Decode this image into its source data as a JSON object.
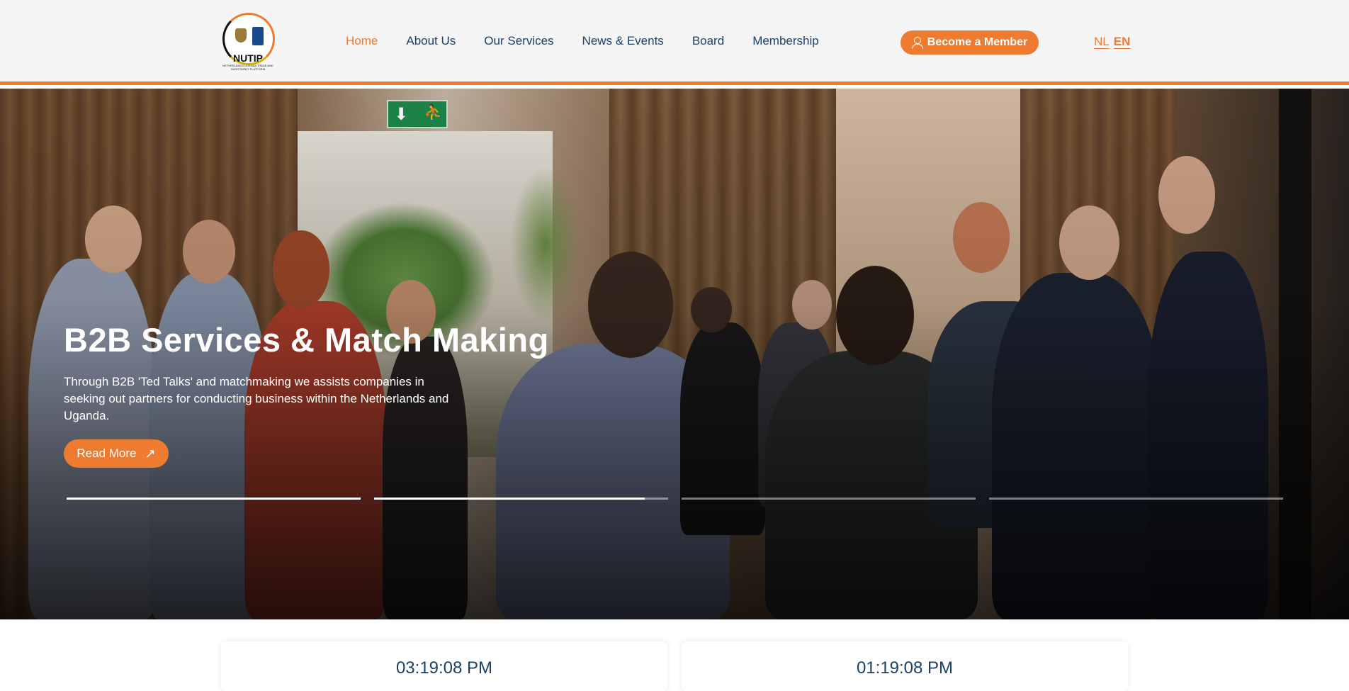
{
  "brand": {
    "logo_text": "NUTIP",
    "logo_subtitle": "NETHERLANDS UGANDA TRADE AND INVESTMENT PLATFORM"
  },
  "nav": {
    "items": [
      {
        "label": "Home",
        "active": true
      },
      {
        "label": "About Us",
        "active": false
      },
      {
        "label": "Our Services",
        "active": false
      },
      {
        "label": "News & Events",
        "active": false
      },
      {
        "label": "Board",
        "active": false
      },
      {
        "label": "Membership",
        "active": false
      }
    ]
  },
  "cta": {
    "label": "Become a Member",
    "icon": "user-icon"
  },
  "language": {
    "nl": "NL",
    "en": "EN",
    "selected": "EN"
  },
  "hero": {
    "title": "B2B Services & Match Making",
    "text": "Through B2B 'Ted Talks'  and matchmaking we assists companies in seeking out partners for conducting business within the Netherlands and Uganda.",
    "button_label": "Read More",
    "button_icon": "arrow-up-right-icon",
    "slides": [
      {
        "progress": 1.0
      },
      {
        "progress": 0.92
      },
      {
        "progress": 0.0
      },
      {
        "progress": 0.0
      }
    ]
  },
  "clocks": [
    {
      "time": "03:19:08 PM"
    },
    {
      "time": "01:19:08 PM"
    }
  ],
  "colors": {
    "accent": "#ee7b30",
    "navy": "#1b3f66"
  }
}
